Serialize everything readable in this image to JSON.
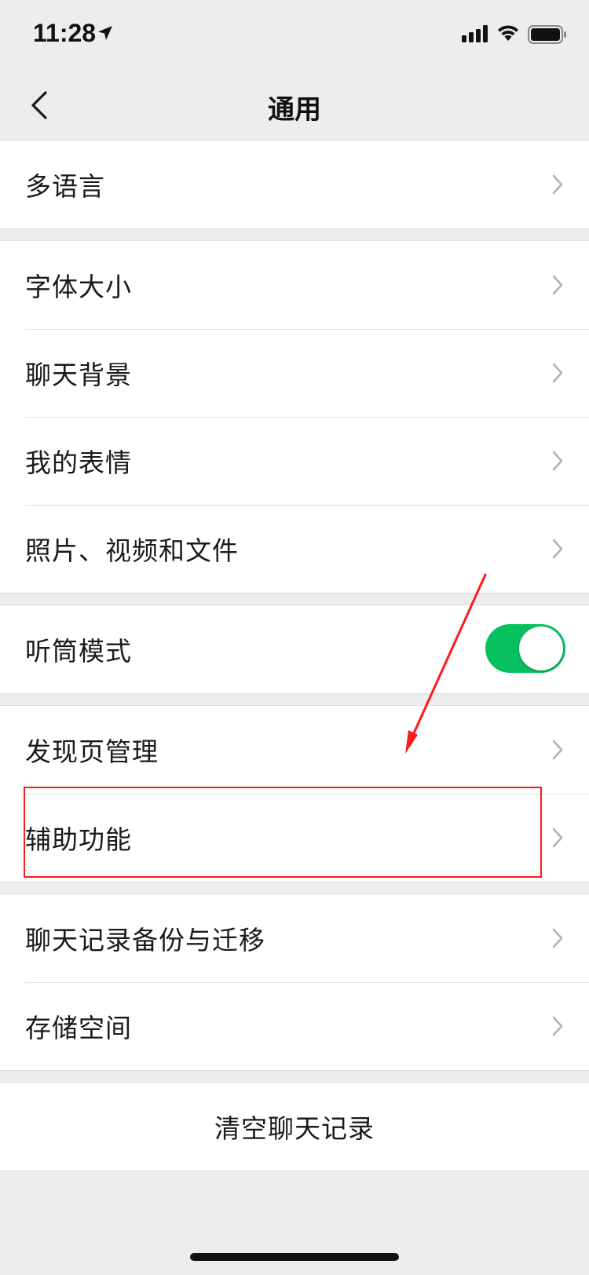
{
  "status_bar": {
    "time": "11:28",
    "location_icon": "location-arrow-icon",
    "signal_icon": "cellular-signal-icon",
    "wifi_icon": "wifi-icon",
    "battery_icon": "battery-icon"
  },
  "nav": {
    "title": "通用",
    "back_icon": "chevron-left-icon"
  },
  "groups": [
    {
      "items": [
        {
          "label": "多语言"
        }
      ]
    },
    {
      "items": [
        {
          "label": "字体大小"
        },
        {
          "label": "聊天背景"
        },
        {
          "label": "我的表情"
        },
        {
          "label": "照片、视频和文件"
        }
      ]
    },
    {
      "items": [
        {
          "label": "听筒模式",
          "toggle": true
        }
      ]
    },
    {
      "items": [
        {
          "label": "发现页管理"
        },
        {
          "label": "辅助功能",
          "highlighted": true
        }
      ]
    },
    {
      "items": [
        {
          "label": "聊天记录备份与迁移"
        },
        {
          "label": "存储空间"
        }
      ]
    }
  ],
  "clear_history": {
    "label": "清空聊天记录"
  },
  "colors": {
    "toggle_on": "#07c160",
    "annotation": "#ff1a1a",
    "background": "#ededed"
  }
}
